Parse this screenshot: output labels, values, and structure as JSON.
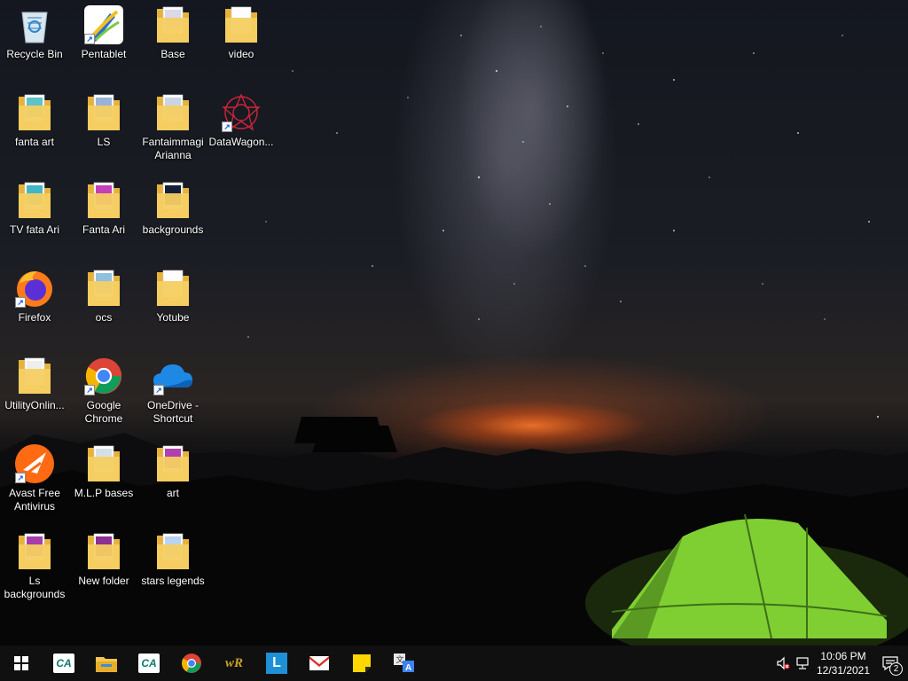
{
  "desktop_icons": [
    {
      "label": "Recycle Bin",
      "icon": "recycle-bin-icon"
    },
    {
      "label": "Pentablet",
      "icon": "pentablet-icon"
    },
    {
      "label": "Base",
      "icon": "folder-icon"
    },
    {
      "label": "video",
      "icon": "folder-icon"
    },
    {
      "label": "fanta art",
      "icon": "folder-icon"
    },
    {
      "label": "LS",
      "icon": "folder-icon"
    },
    {
      "label": "Fantaimmagi Arianna",
      "icon": "folder-icon"
    },
    {
      "label": "DataWagon...",
      "icon": "datawagon-icon"
    },
    {
      "label": "TV  fata Ari",
      "icon": "folder-icon"
    },
    {
      "label": "Fanta Ari",
      "icon": "folder-icon"
    },
    {
      "label": "backgrounds",
      "icon": "folder-icon"
    },
    {
      "label": "Firefox",
      "icon": "firefox-icon"
    },
    {
      "label": "ocs",
      "icon": "folder-icon"
    },
    {
      "label": "Yotube",
      "icon": "folder-icon"
    },
    {
      "label": "UtilityOnlin...",
      "icon": "folder-icon"
    },
    {
      "label": "Google Chrome",
      "icon": "chrome-icon"
    },
    {
      "label": "OneDrive - Shortcut",
      "icon": "onedrive-icon"
    },
    {
      "label": "Avast Free Antivirus",
      "icon": "avast-icon"
    },
    {
      "label": "M.L.P bases",
      "icon": "folder-icon"
    },
    {
      "label": "art",
      "icon": "folder-icon"
    },
    {
      "label": "Ls backgrounds",
      "icon": "folder-icon"
    },
    {
      "label": "New folder",
      "icon": "folder-icon"
    },
    {
      "label": "stars legends",
      "icon": "folder-icon"
    }
  ],
  "taskbar": {
    "apps": [
      {
        "icon": "start-icon"
      },
      {
        "icon": "credit-agricole-icon",
        "text": "CA"
      },
      {
        "icon": "file-explorer-icon"
      },
      {
        "icon": "credit-agricole-icon",
        "text": "CA"
      },
      {
        "icon": "chrome-icon"
      },
      {
        "icon": "wr-icon",
        "text": "wR"
      },
      {
        "icon": "l-app-icon",
        "text": "L"
      },
      {
        "icon": "gmail-icon"
      },
      {
        "icon": "sticky-notes-icon"
      },
      {
        "icon": "translate-icon"
      }
    ],
    "clock": {
      "time": "10:06 PM",
      "date": "12/31/2021"
    },
    "notification_count": "2"
  },
  "colors": {
    "taskbar": "#101010",
    "folder": "#f3c64f",
    "tent": "#8fe03a"
  }
}
